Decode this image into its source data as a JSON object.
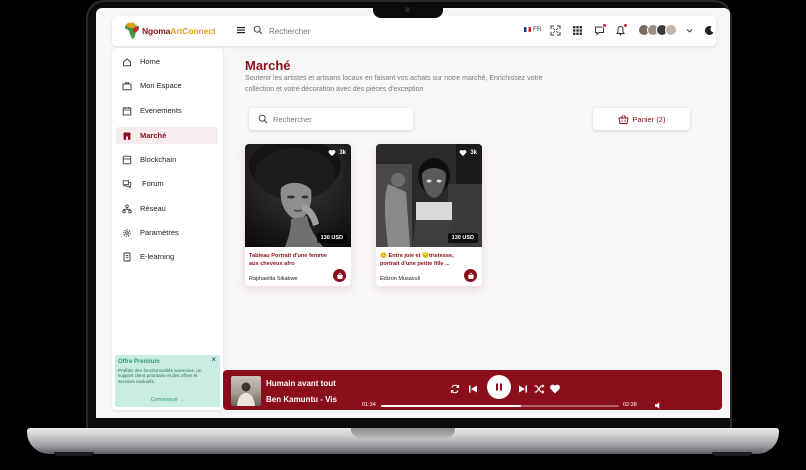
{
  "app": {
    "brand_main": "Ngoma",
    "brand_accent": "ArtConnect",
    "accent_color": "#8b0e1c",
    "highlight_color": "#e0a11a"
  },
  "topbar": {
    "search_placeholder": "Rechercher",
    "language": "FR",
    "icons": [
      "menu-icon",
      "search-icon",
      "expand-icon",
      "apps-grid-icon",
      "messages-icon",
      "bell-icon",
      "moon-icon"
    ]
  },
  "sidebar": {
    "items": [
      {
        "label": "Home",
        "icon": "home-icon"
      },
      {
        "label": "Mon Espace",
        "icon": "briefcase-icon"
      },
      {
        "label": "Evenements",
        "icon": "calendar-icon"
      },
      {
        "label": "Marché",
        "icon": "store-icon",
        "active": true
      },
      {
        "label": "Blockchain",
        "icon": "blockchain-icon"
      },
      {
        "label": "Forum",
        "icon": "forum-icon"
      },
      {
        "label": "Réseau",
        "icon": "network-icon"
      },
      {
        "label": "Paramètres",
        "icon": "gear-icon"
      },
      {
        "label": "E-learning",
        "icon": "elearning-icon"
      }
    ],
    "premium": {
      "title": "Offre Premium",
      "text": "Profitez des fonctionnalités avancées, un support client prioritaire et des offres et services exclusifs.",
      "link": "Commencer →",
      "close": "×"
    }
  },
  "main": {
    "title": "Marché",
    "subtitle": "Soutenir les artistes et artisans locaux en faisant vos achats sur notre marché, Enrichissez votre collection et votre décoration avec des pièces d'exception",
    "search_placeholder": "Rechercher",
    "cart_label": "Panier (2)",
    "products": [
      {
        "title": "Tableau Portrait d'une femme aux cheveux afro",
        "author": "Raphaelita Sikabwe",
        "price": "130 USD",
        "likes": "3k"
      },
      {
        "title": "😊 Entre joie et 😔tristesse, portrait d'une petite fille ...",
        "author": "Edizon Musavuli",
        "price": "130 USD",
        "likes": "3k"
      }
    ]
  },
  "player": {
    "title": "Humain avant tout",
    "artist": "Ben Kamuntu - Vis",
    "elapsed": "01:34",
    "duration": "02:38",
    "progress": 0.59
  }
}
